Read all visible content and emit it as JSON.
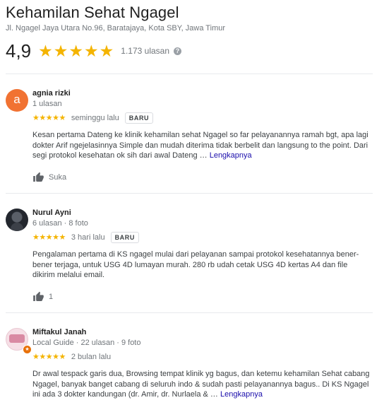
{
  "business": {
    "name": "Kehamilan Sehat Ngagel",
    "address": "Jl. Ngagel Jaya Utara No.96, Baratajaya, Kota SBY, Jawa Timur",
    "rating": "4,9",
    "stars": 5,
    "review_count": "1.173 ulasan",
    "help_glyph": "?"
  },
  "reviews": [
    {
      "avatar_letter": "a",
      "avatar_color": "#f17232",
      "name": "agnia rizki",
      "meta": "1 ulasan",
      "stars": 5,
      "time": "seminggu lalu",
      "badge": "BARU",
      "text": "Kesan pertama Dateng ke klinik kehamilan sehat Ngagel so far pelayanannya ramah bgt, apa lagi dokter Arif ngejelasinnya Simple dan mudah diterima tidak berbelit dan langsung to the point. Dari segi protokol kesehatan ok sih dari awal Dateng …",
      "more": "Lengkapnya",
      "like_label": "Suka"
    },
    {
      "name": "Nurul Ayni",
      "meta": "6 ulasan · 8 foto",
      "stars": 5,
      "time": "3 hari lalu",
      "badge": "BARU",
      "text": "Pengalaman pertama di KS ngagel mulai dari pelayanan sampai protokol kesehatannya bener-bener terjaga, untuk USG 4D lumayan murah. 280 rb udah cetak USG 4D kertas A4 dan file dikirim melalui email.",
      "like_label": "1"
    },
    {
      "name": "Miftakul Janah",
      "meta": "Local Guide · 22 ulasan · 9 foto",
      "stars": 5,
      "time": "2 bulan lalu",
      "text": "Dr awal tespack garis dua, Browsing tempat klinik yg bagus, dan ketemu kehamilan Sehat cabang Ngagel, banyak banget cabang di seluruh indo & sudah pasti pelayanannya bagus.. Di KS Ngagel ini ada 3 dokter kandungan (dr. Amir, dr. Nurlaela & …",
      "more": "Lengkapnya",
      "guide_badge_glyph": "★"
    }
  ],
  "colors": {
    "star": "#f4b400",
    "link": "#1a0dab",
    "muted": "#70757a"
  }
}
